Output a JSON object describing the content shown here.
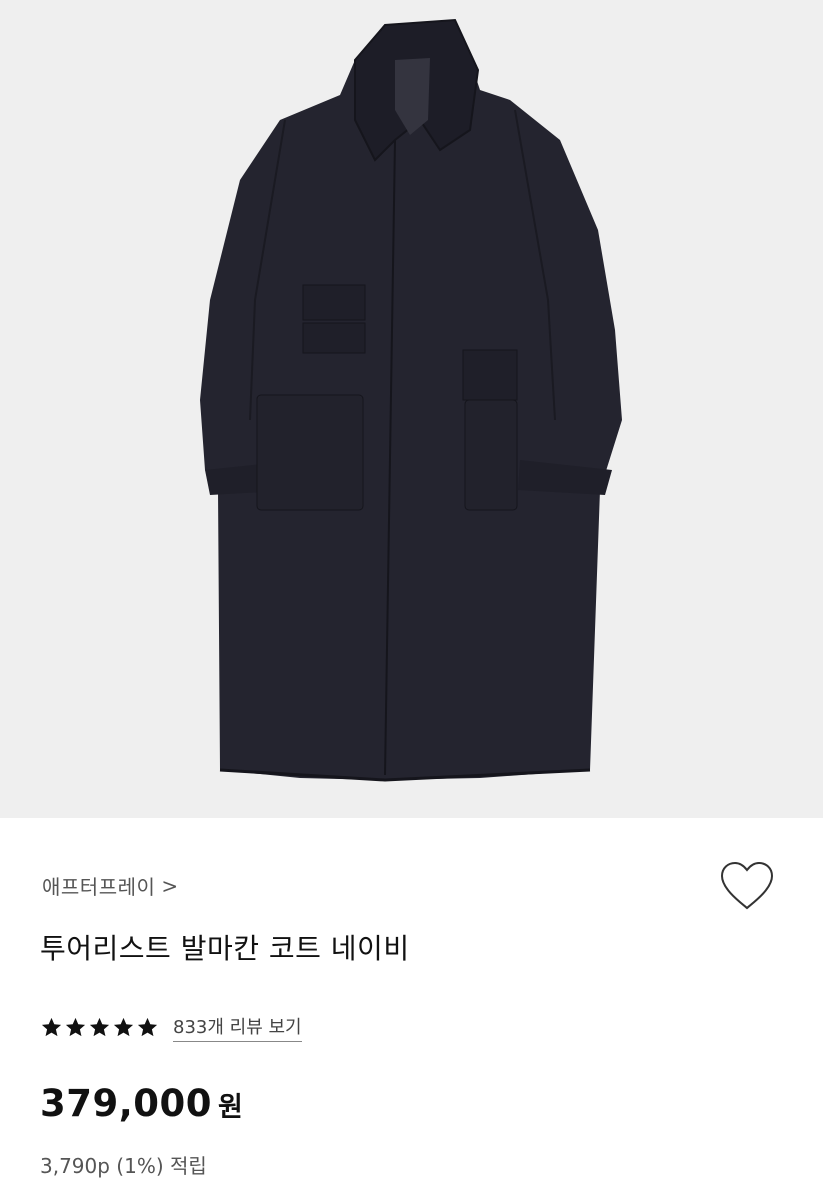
{
  "product": {
    "image_alt": "navy coat product image",
    "brand": "애프터프레이",
    "brand_chevron": ">",
    "title": "투어리스트 발마칸 코트 네이비",
    "rating_stars": 5,
    "review_link": "833개 리뷰 보기",
    "price_amount": "379,000",
    "price_unit": "원",
    "points": "3,790p (1%) 적립"
  },
  "colors": {
    "hero_bg": "#efefef",
    "coat": "#24242f",
    "text_primary": "#111111",
    "text_secondary": "#555555"
  },
  "icons": {
    "wishlist": "heart-outline-icon",
    "rating": "star-icon",
    "brand_link": "chevron-right-icon"
  }
}
